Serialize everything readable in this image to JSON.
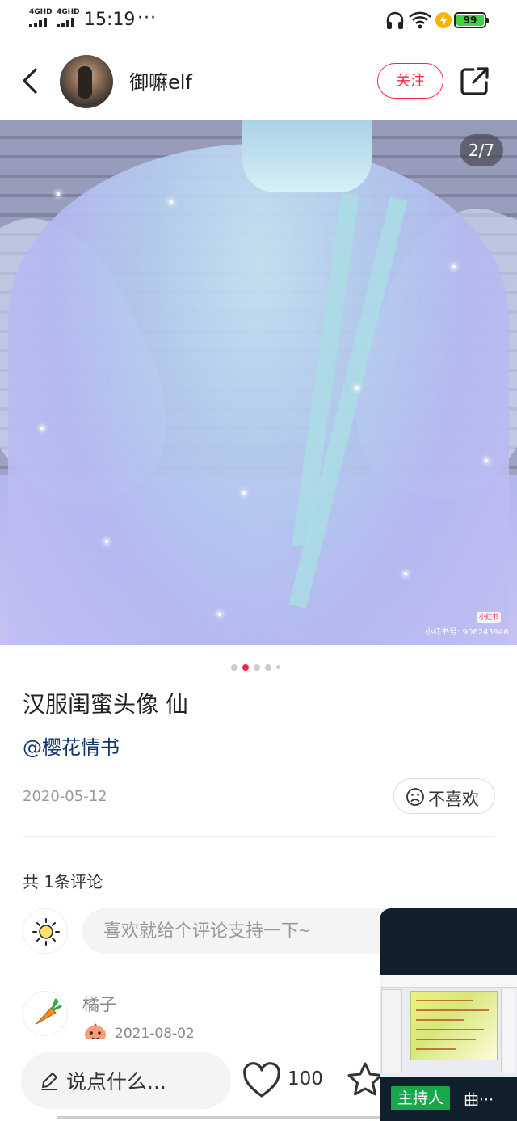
{
  "status_bar": {
    "signal1": "4GHD",
    "signal2": "4GHD",
    "time": "15:19",
    "more": "···",
    "battery": "99"
  },
  "header": {
    "author": "御嘛elf",
    "follow": "关注"
  },
  "photo": {
    "counter": "2/7",
    "watermark_logo": "小红书",
    "watermark_text": "小红书号: 906243946",
    "current_index": 2,
    "total": 7
  },
  "note": {
    "title": "汉服闺蜜头像 仙",
    "mention": "@樱花情书",
    "date": "2020-05-12",
    "dislike": "不喜欢"
  },
  "comments": {
    "count_label": "共 1条评论",
    "input_placeholder": "喜欢就给个评论支持一下~",
    "items": [
      {
        "name": "橘子",
        "date": "2021-08-02"
      }
    ]
  },
  "bottom_bar": {
    "say": "说点什么...",
    "likes": "100"
  },
  "float_window": {
    "host_badge": "主持人",
    "host_name": "曲···"
  },
  "colors": {
    "brand_red": "#ff2442",
    "mention_blue": "#133667",
    "host_green": "#17a84b"
  },
  "icons": [
    "back-icon",
    "share-icon",
    "sad-face-icon",
    "sun-avatar-icon",
    "carrot-avatar-icon",
    "pen-icon",
    "heart-icon",
    "star-icon",
    "headphones-icon",
    "wifi-icon",
    "charging-icon"
  ]
}
